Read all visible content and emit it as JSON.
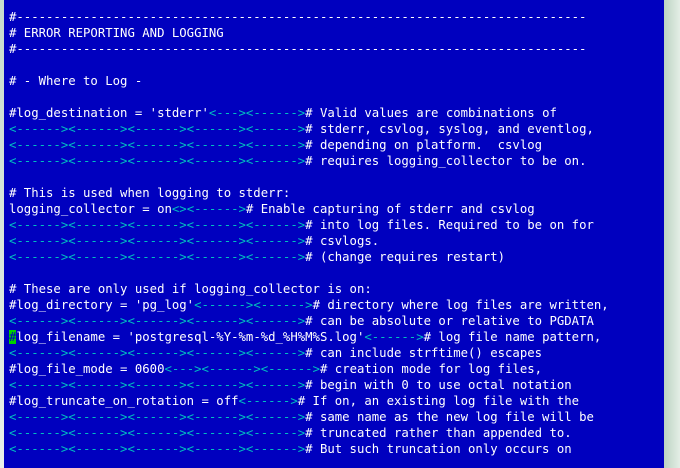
{
  "cursor_char": "#",
  "lines": [
    [
      {
        "t": "#-----------------------------------------------------------------------------"
      }
    ],
    [
      {
        "t": "# ERROR REPORTING AND LOGGING"
      }
    ],
    [
      {
        "t": "#-----------------------------------------------------------------------------"
      }
    ],
    [],
    [
      {
        "t": "# - Where to Log -"
      }
    ],
    [],
    [
      {
        "t": "#log_destination = 'stderr'"
      },
      {
        "t": "<--->",
        "tab": true
      },
      {
        "t": "<------>",
        "tab": true
      },
      {
        "t": "# Valid values are combinations of"
      }
    ],
    [
      {
        "t": "<------><------><------><------><------>",
        "tab": true
      },
      {
        "t": "# stderr, csvlog, syslog, and eventlog,"
      }
    ],
    [
      {
        "t": "<------><------><------><------><------>",
        "tab": true
      },
      {
        "t": "# depending on platform.  csvlog"
      }
    ],
    [
      {
        "t": "<------><------><------><------><------>",
        "tab": true
      },
      {
        "t": "# requires logging_collector to be on."
      }
    ],
    [],
    [
      {
        "t": "# This is used when logging to stderr:"
      }
    ],
    [
      {
        "t": "logging_collector = on"
      },
      {
        "t": "<>",
        "tab": true
      },
      {
        "t": "<------>",
        "tab": true
      },
      {
        "t": "# Enable capturing of stderr and csvlog"
      }
    ],
    [
      {
        "t": "<------><------><------><------><------>",
        "tab": true
      },
      {
        "t": "# into log files. Required to be on for"
      }
    ],
    [
      {
        "t": "<------><------><------><------><------>",
        "tab": true
      },
      {
        "t": "# csvlogs."
      }
    ],
    [
      {
        "t": "<------><------><------><------><------>",
        "tab": true
      },
      {
        "t": "# (change requires restart)"
      }
    ],
    [],
    [
      {
        "t": "# These are only used if logging_collector is on:"
      }
    ],
    [
      {
        "t": "#log_directory = 'pg_log'"
      },
      {
        "t": "<------><------>",
        "tab": true
      },
      {
        "t": "# directory where log files are written,"
      }
    ],
    [
      {
        "t": "<------><------><------><------><------>",
        "tab": true
      },
      {
        "t": "# can be absolute or relative to PGDATA"
      }
    ],
    [
      {
        "t": "#",
        "cursor": true
      },
      {
        "t": "log_filename = 'postgresql-%Y-%m-%d_%H%M%S.log'"
      },
      {
        "t": "<------>",
        "tab": true
      },
      {
        "t": "# log file name pattern,"
      }
    ],
    [
      {
        "t": "<------><------><------><------><------>",
        "tab": true
      },
      {
        "t": "# can include strftime() escapes"
      }
    ],
    [
      {
        "t": "#log_file_mode = 0600"
      },
      {
        "t": "<--->",
        "tab": true
      },
      {
        "t": "<------><------>",
        "tab": true
      },
      {
        "t": "# creation mode for log files,"
      }
    ],
    [
      {
        "t": "<------><------><------><------><------>",
        "tab": true
      },
      {
        "t": "# begin with 0 to use octal notation"
      }
    ],
    [
      {
        "t": "#log_truncate_on_rotation = off"
      },
      {
        "t": "<------>",
        "tab": true
      },
      {
        "t": "# If on, an existing log file with the"
      }
    ],
    [
      {
        "t": "<------><------><------><------><------>",
        "tab": true
      },
      {
        "t": "# same name as the new log file will be"
      }
    ],
    [
      {
        "t": "<------><------><------><------><------>",
        "tab": true
      },
      {
        "t": "# truncated rather than appended to."
      }
    ],
    [
      {
        "t": "<------><------><------><------><------>",
        "tab": true
      },
      {
        "t": "# But such truncation only occurs on"
      }
    ]
  ]
}
